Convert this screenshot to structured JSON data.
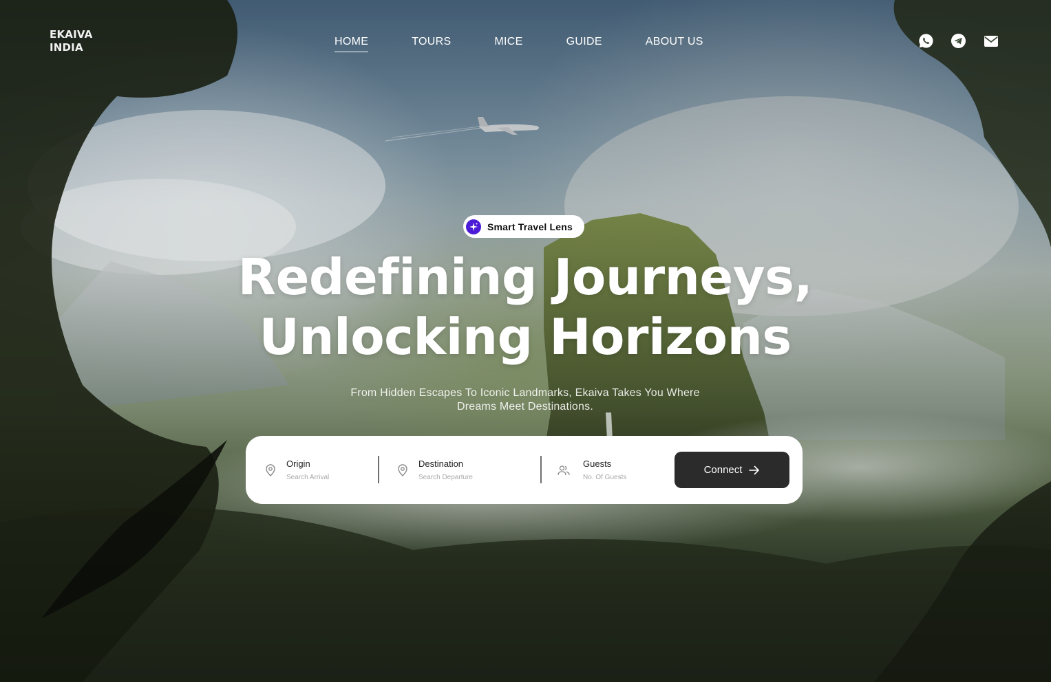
{
  "brand": {
    "line1": "EKAIVA",
    "line2": "INDIA"
  },
  "nav": {
    "items": [
      {
        "label": "HOME",
        "active": true
      },
      {
        "label": "TOURS",
        "active": false
      },
      {
        "label": "MICE",
        "active": false
      },
      {
        "label": "GUIDE",
        "active": false
      },
      {
        "label": "ABOUT US",
        "active": false
      }
    ]
  },
  "socials": [
    {
      "icon": "whatsapp-icon"
    },
    {
      "icon": "telegram-icon"
    },
    {
      "icon": "mail-icon"
    }
  ],
  "badge": {
    "icon": "sparkle-icon",
    "label": "Smart Travel Lens",
    "color": "#4b1bd6"
  },
  "hero": {
    "headline_line1": "Redefining Journeys,",
    "headline_line2": "Unlocking Horizons",
    "subtitle_line1": "From Hidden Escapes To Iconic Landmarks, Ekaiva Takes You Where",
    "subtitle_line2": "Dreams Meet Destinations."
  },
  "search": {
    "origin": {
      "label": "Origin",
      "placeholder": "Search Arrival",
      "icon": "location-pin-icon"
    },
    "destination": {
      "label": "Destination",
      "placeholder": "Search Departure",
      "icon": "location-pin-icon"
    },
    "guests": {
      "label": "Guests",
      "placeholder": "No. Of Guests",
      "icon": "users-icon"
    },
    "button_label": "Connect",
    "button_color": "#2b2b2b"
  }
}
